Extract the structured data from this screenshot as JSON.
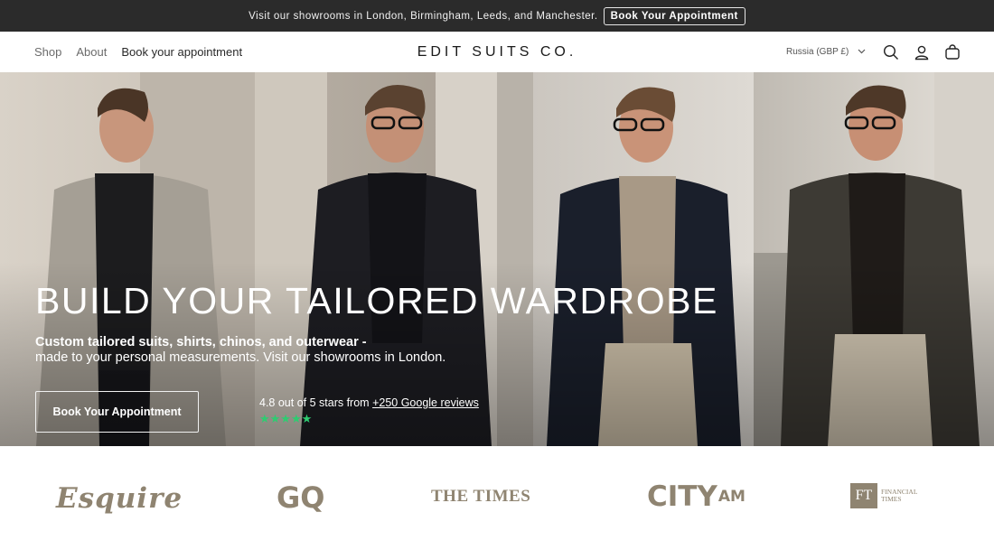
{
  "announcement": {
    "text": "Visit our showrooms in London, Birmingham, Leeds, and Manchester.",
    "button_label": "Book Your Appointment"
  },
  "nav": {
    "items": [
      {
        "label": "Shop"
      },
      {
        "label": "About"
      },
      {
        "label": "Book your appointment"
      }
    ]
  },
  "brand": {
    "logo_text": "EDIT SUITS CO."
  },
  "header": {
    "currency": "Russia (GBP £)",
    "icons": [
      "search-icon",
      "account-icon",
      "cart-icon",
      "chevron-down-icon"
    ]
  },
  "hero": {
    "title": "BUILD YOUR TAILORED WARDROBE",
    "subtitle_line1": "Custom tailored suits, shirts, chinos, and outerwear -",
    "subtitle_line2": "made to your personal measurements. Visit our showrooms in London.",
    "cta_label": "Book Your Appointment",
    "rating_text": "4.8 out of 5 stars from",
    "rating_link": "+250 Google reviews",
    "stars": "★★★★★",
    "rating_value": 4.8,
    "star_color": "#2ecc71"
  },
  "press": {
    "esquire": "Esquire",
    "gq": "GQ",
    "times": "THE TIMES",
    "city": "CITY",
    "am": "AM",
    "ft_box": "FT",
    "ft_text": "FINANCIAL TIMES"
  },
  "colors": {
    "announcement_bg": "#2b2b2b",
    "press_logo": "#8f8471"
  }
}
